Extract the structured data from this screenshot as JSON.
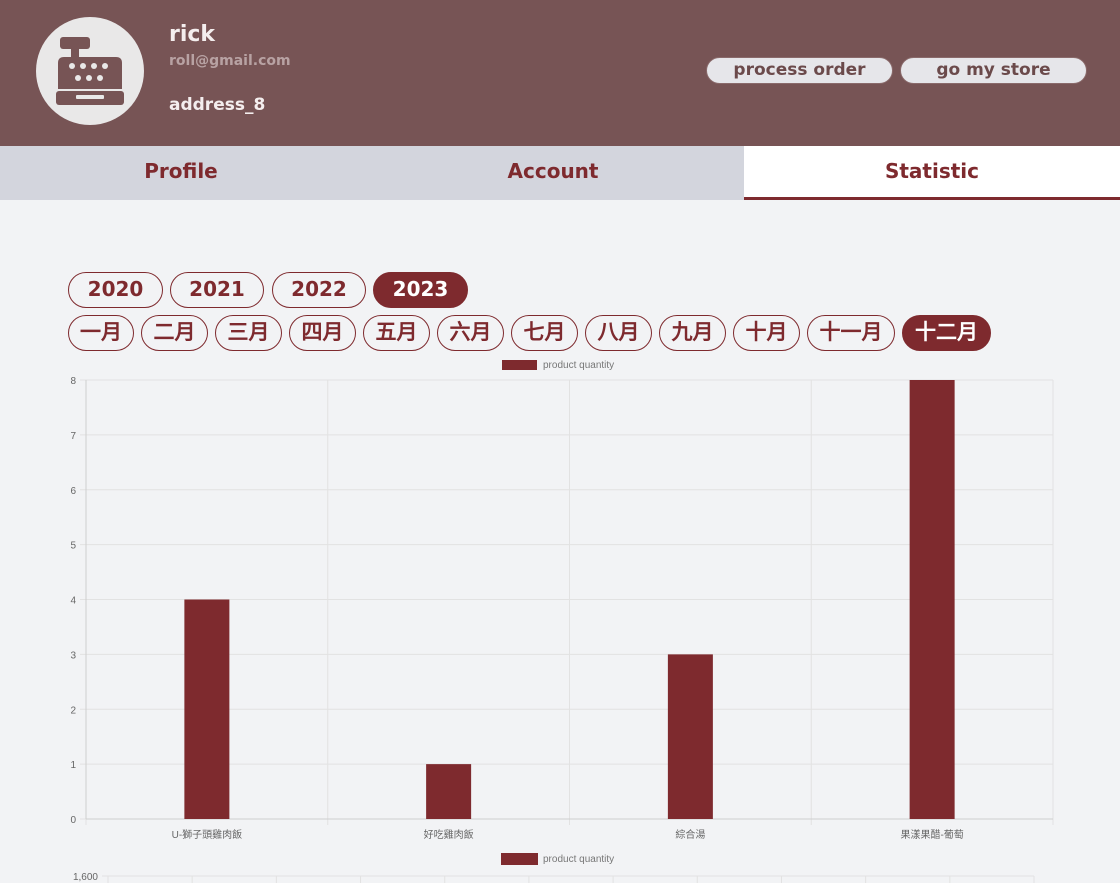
{
  "header": {
    "name": "rick",
    "email": "roll@gmail.com",
    "address": "address_8",
    "avatar_icon": "cash-register-icon",
    "process_order_label": "process order",
    "go_my_store_label": "go my store"
  },
  "tabs": [
    {
      "label": "Profile"
    },
    {
      "label": "Account"
    },
    {
      "label": "Statistic"
    }
  ],
  "active_tab": "Statistic",
  "years": [
    "2020",
    "2021",
    "2022",
    "2023"
  ],
  "selected_year": "2023",
  "months": [
    "一月",
    "二月",
    "三月",
    "四月",
    "五月",
    "六月",
    "七月",
    "八月",
    "九月",
    "十月",
    "十一月",
    "十二月"
  ],
  "selected_month": "十二月",
  "colors": {
    "header_bg": "#775455",
    "accent": "#7e2a2e",
    "tab_inactive_bg": "#d3d5dd",
    "page_bg": "#f2f3f5"
  },
  "chart_data": [
    {
      "type": "bar",
      "legend": "product quantity",
      "legend_position": "top-center",
      "grid": true,
      "categories": [
        "U-獅子頭雞肉飯",
        "好吃雞肉飯",
        "綜合湯",
        "果漾果醋-葡萄"
      ],
      "values": [
        4,
        1,
        3,
        8
      ],
      "ylim": [
        0,
        8
      ],
      "yticks": [
        "0",
        "1",
        "2",
        "3",
        "4",
        "5",
        "6",
        "7",
        "8"
      ]
    },
    {
      "type": "bar",
      "legend": "product quantity",
      "legend_position": "top-center",
      "grid": true,
      "yticks_visible": [
        "1,600"
      ]
    }
  ]
}
